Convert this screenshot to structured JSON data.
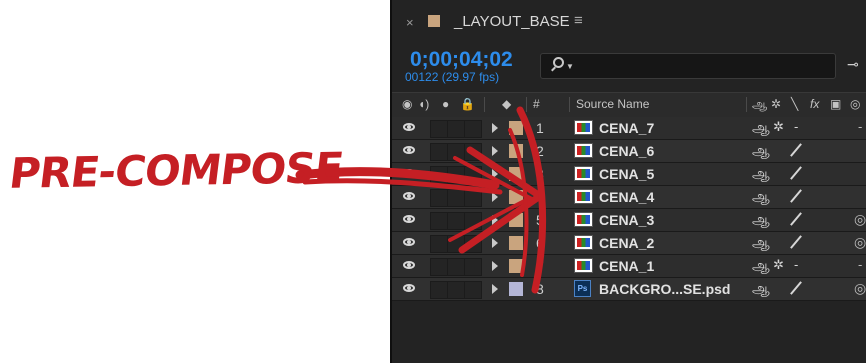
{
  "annotation": {
    "text": "PRE-COMPOSE",
    "color": "#c51f24"
  },
  "composition": {
    "tab": {
      "title": "_LAYOUT_BASE",
      "close_glyph": "×",
      "menu_glyph": "≡",
      "swatch_color": "#c9a47e"
    },
    "timecode": "0;00;04;02",
    "frame_info": "00122 (29.97 fps)",
    "search": {
      "placeholder": "",
      "icon": "search-icon"
    },
    "accent_color": "#2d8ceb"
  },
  "columns": {
    "av_icons": [
      "eye-icon",
      "speaker-icon",
      "solo-dot-icon",
      "lock-icon"
    ],
    "label_icon": "tag-icon",
    "number": "#",
    "source_name": "Source Name",
    "switch_icons": [
      "shy-icon",
      "collapse-sun-icon",
      "quality-slash-icon",
      "fx-icon",
      "frame-blend-icon",
      "motion-blur-icon"
    ],
    "fx_text": "fx"
  },
  "layers": [
    {
      "num": "1",
      "name": "CENA_7",
      "type": "comp",
      "label_color": "#c9a47e",
      "sw1": "ஆ",
      "sw2": "✲",
      "sw3": "-",
      "right": "-"
    },
    {
      "num": "2",
      "name": "CENA_6",
      "type": "comp",
      "label_color": "#c9a47e",
      "sw1": "ஆ",
      "sw2": "",
      "sw3": "/",
      "right": ""
    },
    {
      "num": "3",
      "name": "CENA_5",
      "type": "comp",
      "label_color": "#c9a47e",
      "sw1": "ஆ",
      "sw2": "",
      "sw3": "/",
      "right": ""
    },
    {
      "num": "4",
      "name": "CENA_4",
      "type": "comp",
      "label_color": "#c9a47e",
      "sw1": "ஆ",
      "sw2": "",
      "sw3": "/",
      "right": ""
    },
    {
      "num": "5",
      "name": "CENA_3",
      "type": "comp",
      "label_color": "#c9a47e",
      "sw1": "ஆ",
      "sw2": "",
      "sw3": "/",
      "right": "◎"
    },
    {
      "num": "6",
      "name": "CENA_2",
      "type": "comp",
      "label_color": "#c9a47e",
      "sw1": "ஆ",
      "sw2": "",
      "sw3": "/",
      "right": "◎"
    },
    {
      "num": "7",
      "name": "CENA_1",
      "type": "comp",
      "label_color": "#c9a47e",
      "sw1": "ஆ",
      "sw2": "✲",
      "sw3": "-",
      "right": "-"
    },
    {
      "num": "8",
      "name": "BACKGRO...SE.psd",
      "type": "psd",
      "label_color": "#b4b6d6",
      "sw1": "ஆ",
      "sw2": "",
      "sw3": "/",
      "right": "◎"
    }
  ]
}
